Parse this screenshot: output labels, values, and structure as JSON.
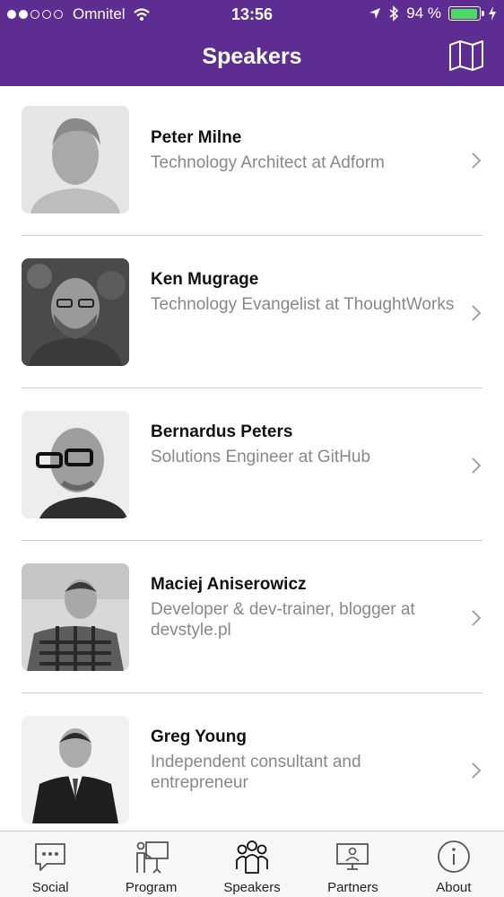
{
  "status_bar": {
    "carrier": "Omnitel",
    "time": "13:56",
    "battery": "94 %",
    "battery_level": 0.94
  },
  "nav": {
    "title": "Speakers"
  },
  "speakers": [
    {
      "name": "Peter Milne",
      "role": "Technology Architect at Adform"
    },
    {
      "name": "Ken Mugrage",
      "role": "Technology Evangelist at ThoughtWorks"
    },
    {
      "name": "Bernardus Peters",
      "role": "Solutions Engineer at GitHub"
    },
    {
      "name": "Maciej Aniserowicz",
      "role": "Developer & dev-trainer, blogger at devstyle.pl"
    },
    {
      "name": "Greg Young",
      "role": "Independent consultant and entrepreneur"
    }
  ],
  "tabs": [
    {
      "label": "Social",
      "icon": "chat-bubble-icon"
    },
    {
      "label": "Program",
      "icon": "presentation-icon"
    },
    {
      "label": "Speakers",
      "icon": "people-icon",
      "active": true
    },
    {
      "label": "Partners",
      "icon": "partners-monitor-icon"
    },
    {
      "label": "About",
      "icon": "info-icon"
    }
  ],
  "colors": {
    "primary": "#5e2d91",
    "battery": "#4cd964",
    "secondary_text": "#888888"
  }
}
